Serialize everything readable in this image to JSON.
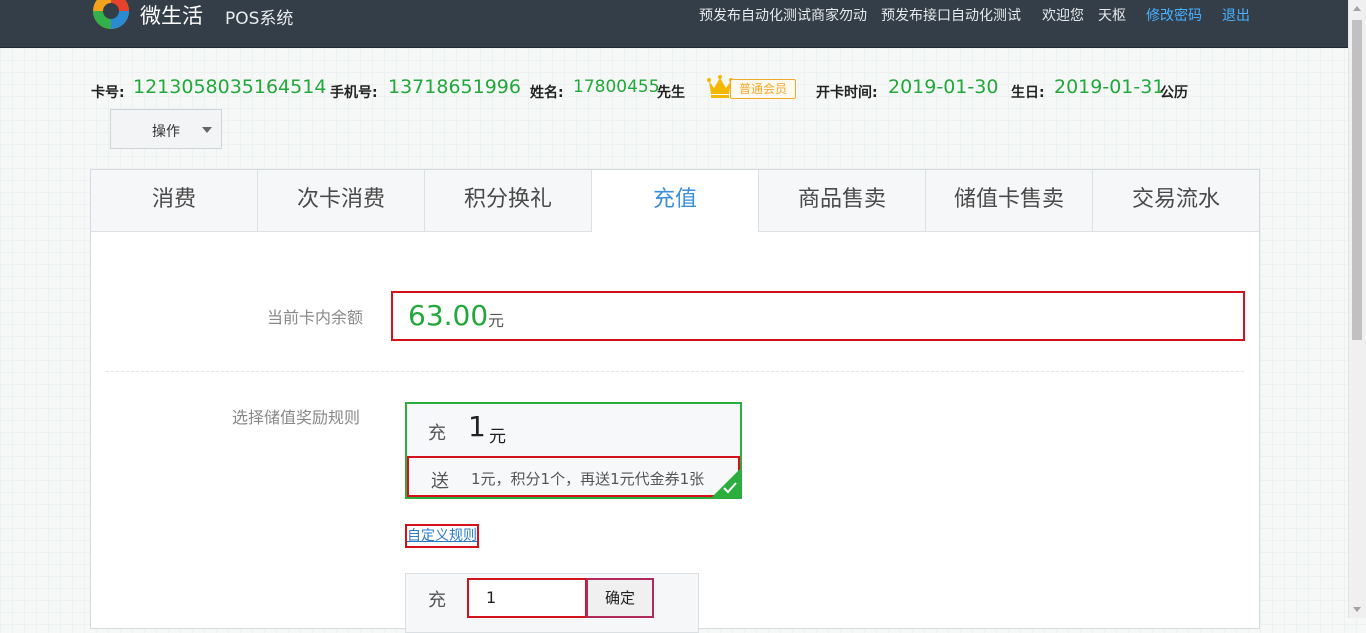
{
  "header": {
    "brand": "微生活",
    "brand_sub": "POS系统",
    "links": [
      "预发布自动化测试商家勿动",
      "预发布接口自动化测试",
      "欢迎您",
      "天枢",
      "修改密码",
      "退出"
    ]
  },
  "member": {
    "card_label": "卡号:",
    "card_no": "1213058035164514",
    "phone_label": "手机号:",
    "phone": "13718651996",
    "name_label": "姓名:",
    "name": "17800455",
    "title": "先生",
    "level": "普通会员",
    "open_label": "开卡时间:",
    "open_date": "2019-01-30",
    "birthday_label": "生日:",
    "birthday": "2019-01-31",
    "calendar": "公历"
  },
  "operation": {
    "label": "操作"
  },
  "tabs": [
    "消费",
    "次卡消费",
    "积分换礼",
    "充值",
    "商品售卖",
    "储值卡售卖",
    "交易流水"
  ],
  "active_tab": "充值",
  "recharge": {
    "balance_label": "当前卡内余额",
    "balance": "63.00",
    "balance_unit": "元",
    "rule_label": "选择储值奖励规则",
    "rule_chong": "充",
    "rule_amount": "1",
    "rule_unit": "元",
    "gift_song": "送",
    "gift_text": "1元，积分1个，再送1元代金券1张",
    "custom_rule": "自定义规则",
    "input_chong": "充",
    "input_value": "1",
    "confirm": "确定"
  },
  "colors": {
    "header_bg": "#333e48",
    "value_green": "#22a83a",
    "active_tab": "#3a8fd8",
    "highlight_red": "#d5111c",
    "selected_green": "#2cae3e"
  }
}
